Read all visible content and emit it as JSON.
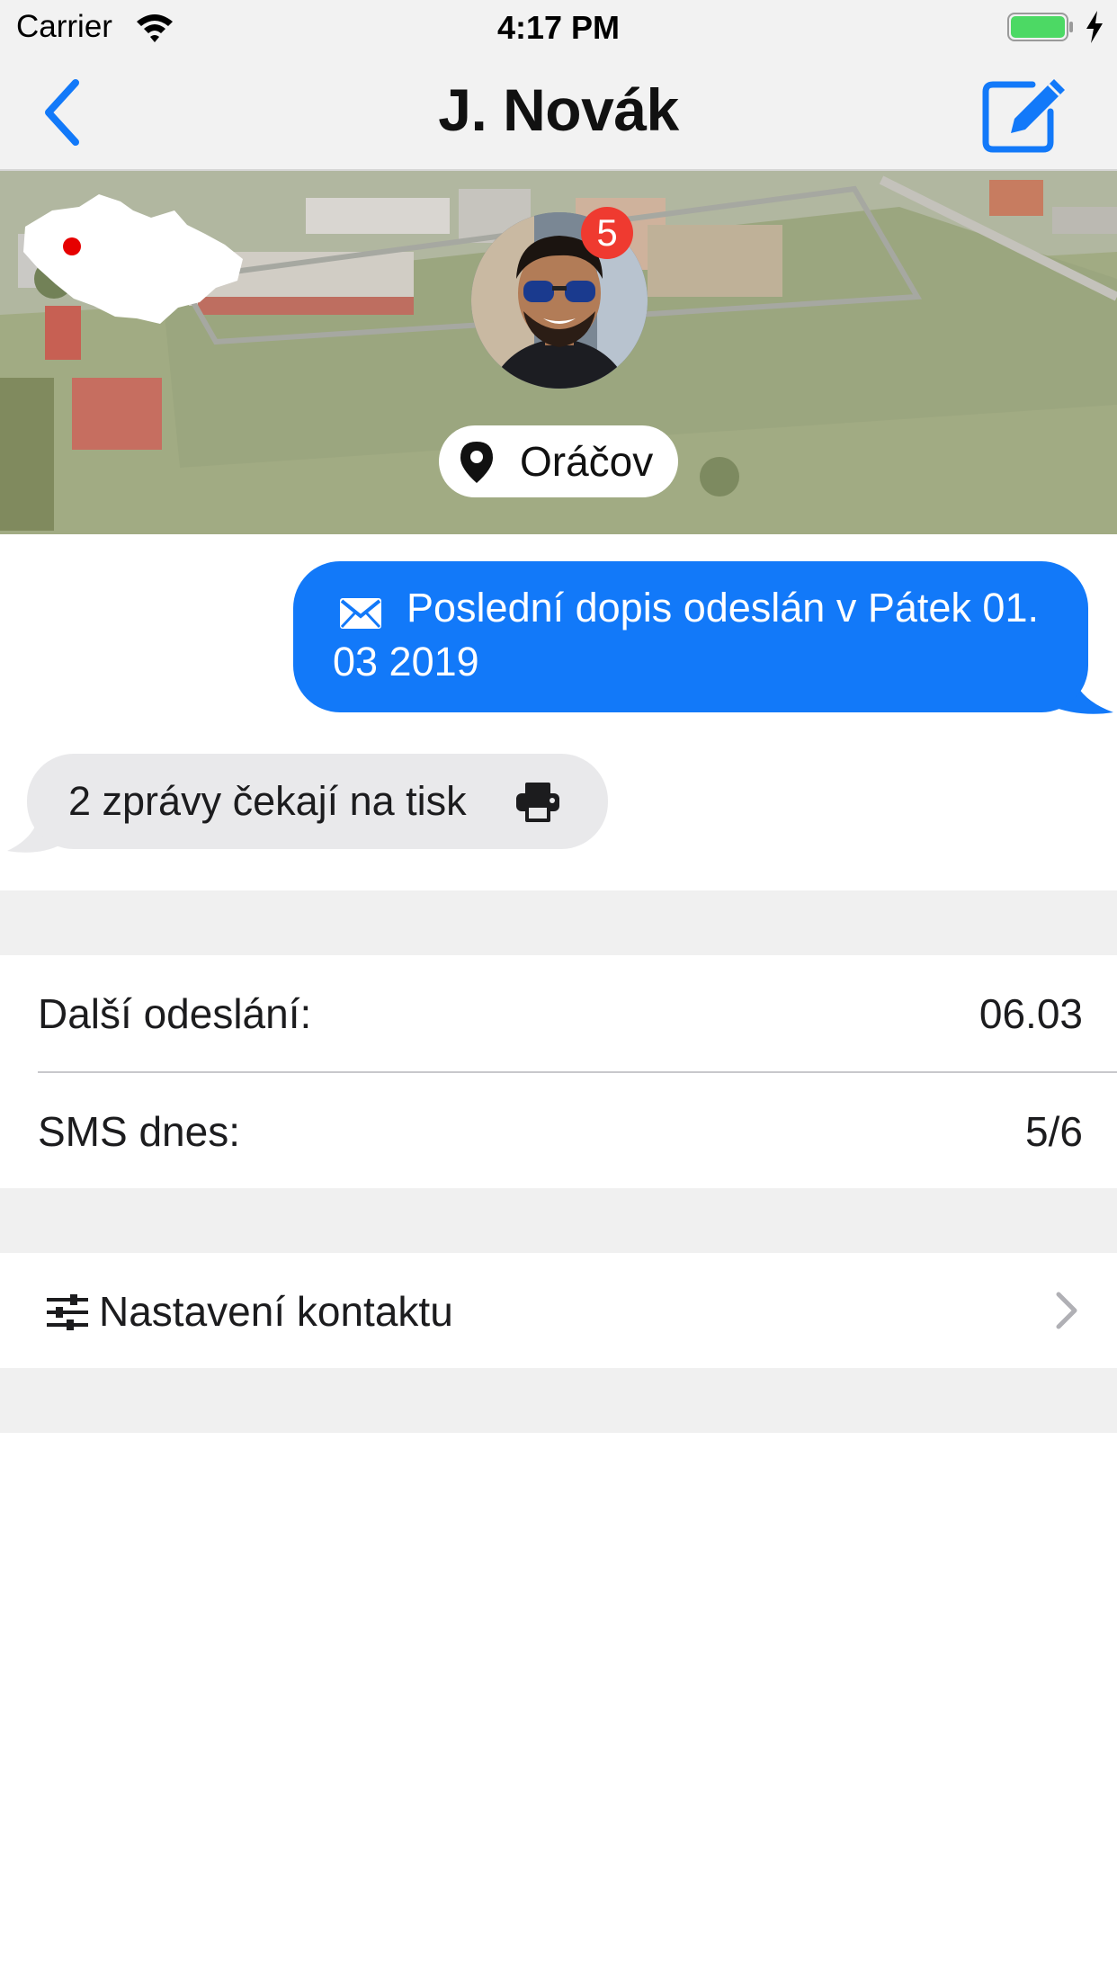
{
  "status_bar": {
    "carrier": "Carrier",
    "time": "4:17 PM"
  },
  "nav": {
    "title": "J. Novák",
    "back_icon": "chevron-left-icon",
    "compose_icon": "compose-icon"
  },
  "hero": {
    "badge_count": "5",
    "location": "Oráčov",
    "map_icon": "czech-map-icon"
  },
  "messages": {
    "outgoing_text": "Poslední dopis odeslán v Pátek 01. 03 2019",
    "incoming_text": "2 zprávy čekají na tisk"
  },
  "info": {
    "next_send_label": "Další odeslání:",
    "next_send_value": "06.03",
    "sms_label": "SMS dnes:",
    "sms_value": "5/6"
  },
  "settings": {
    "label": "Nastavení kontaktu"
  },
  "colors": {
    "accent": "#1279f9",
    "badge": "#ef3a30",
    "incoming_bubble": "#e9e9eb",
    "section_background": "#f0f0f0",
    "battery": "#4cd964"
  }
}
